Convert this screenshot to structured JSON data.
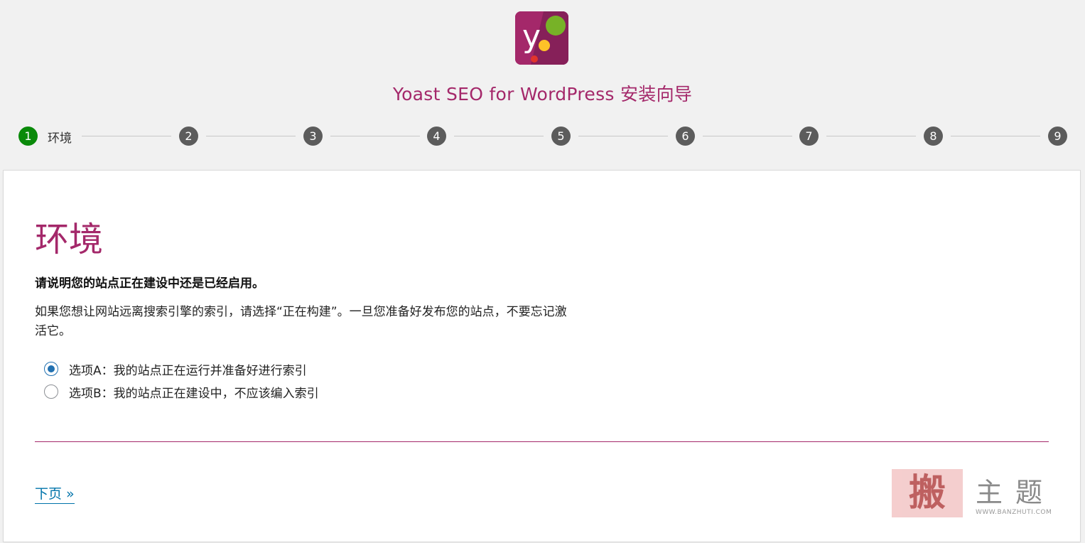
{
  "colors": {
    "brand": "#a4286a",
    "active_step": "#0a8a0a",
    "inactive_step": "#5c5c5c",
    "link": "#0073aa",
    "radio": "#2271b1"
  },
  "header": {
    "logo": "yoast-logo-icon",
    "title": "Yoast SEO for WordPress 安装向导"
  },
  "steps": [
    {
      "number": "1",
      "label": "环境",
      "active": true
    },
    {
      "number": "2"
    },
    {
      "number": "3"
    },
    {
      "number": "4"
    },
    {
      "number": "5"
    },
    {
      "number": "6"
    },
    {
      "number": "7"
    },
    {
      "number": "8"
    },
    {
      "number": "9"
    }
  ],
  "panel": {
    "title": "环境",
    "question": "请说明您的站点正在建设中还是已经启用。",
    "description": "如果您想让网站远离搜索引擎的索引，请选择“正在构建”。一旦您准备好发布您的站点，不要忘记激活它。",
    "options": [
      {
        "label": "选项A：我的站点正在运行并准备好进行索引",
        "checked": true
      },
      {
        "label": "选项B：我的站点正在建设中，不应该编入索引",
        "checked": false
      }
    ],
    "next_link": "下页 »"
  },
  "watermark": {
    "seal": "搬",
    "text": "主题",
    "url": "WWW.BANZHUTI.COM"
  }
}
